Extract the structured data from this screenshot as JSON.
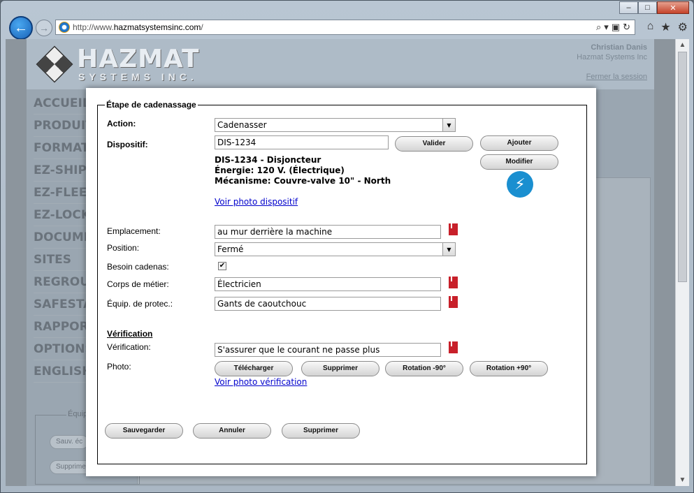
{
  "browser": {
    "url_prefix": "http://www.",
    "url_domain": "hazmatsystemsinc.com",
    "url_suffix": "/"
  },
  "site": {
    "logo_text": "HAZMAT",
    "logo_sub": "SYSTEMS INC.",
    "user_name": "Christian Danis",
    "user_company": "Hazmat Systems Inc",
    "logout": "Fermer la session",
    "nav": [
      "ACCUEIL",
      "PRODUITS",
      "FORMATION",
      "EZ-SHIP",
      "EZ-FLEET",
      "EZ-LOCKOUT",
      "DOCUMENTS",
      "SITES",
      "REGROUPEMENTS",
      "SAFESTATION",
      "RAPPORTS",
      "OPTIONS",
      "ENGLISH"
    ],
    "bg_box_title": "Équip",
    "bg_btn_1": "Sauv. éc",
    "bg_btn_2": "Supprimer"
  },
  "modal": {
    "legend": "Étape de cadenassage",
    "action_label": "Action:",
    "action_value": "Cadenasser",
    "device_label": "Dispositif:",
    "device_value": "DIS-1234",
    "validate_btn": "Valider",
    "add_btn": "Ajouter",
    "modify_btn": "Modifier",
    "device_info_1": "DIS-1234 - Disjoncteur",
    "device_info_2": "Énergie: 120 V. (Électrique)",
    "device_info_3": "Mécanisme: Couvre-valve 10\" - North",
    "device_photo_link": "Voir photo dispositif",
    "location_label": "Emplacement:",
    "location_value": "au mur derrière la machine",
    "position_label": "Position:",
    "position_value": "Fermé",
    "padlock_label": "Besoin cadenas:",
    "padlock_checked": true,
    "trade_label": "Corps de métier:",
    "trade_value": "Électricien",
    "ppe_label": "Équip. de protec.:",
    "ppe_value": "Gants de caoutchouc",
    "verification_heading": "Vérification",
    "verification_label": "Vérification:",
    "verification_value": "S'assurer que le courant ne passe plus",
    "photo_label": "Photo:",
    "upload_btn": "Télécharger",
    "delete_photo_btn": "Supprimer",
    "rotate_left_btn": "Rotation -90°",
    "rotate_right_btn": "Rotation +90°",
    "verification_photo_link": "Voir photo vérification",
    "save_btn": "Sauvegarder",
    "cancel_btn": "Annuler",
    "delete_btn": "Supprimer"
  }
}
